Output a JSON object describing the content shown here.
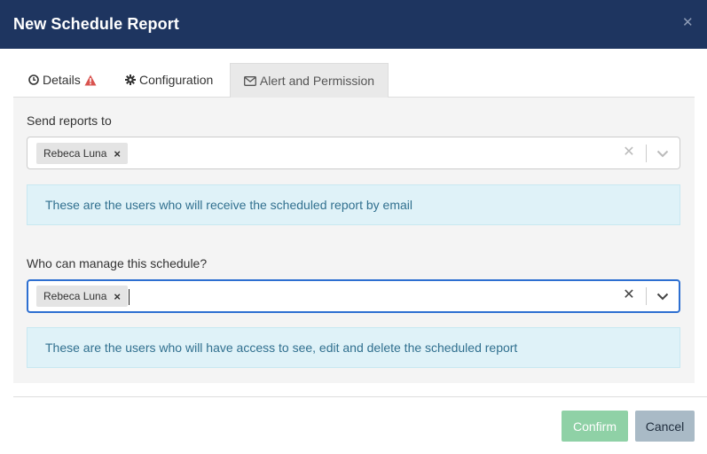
{
  "dialog": {
    "title": "New Schedule Report",
    "close_glyph": "✕"
  },
  "tabs": [
    {
      "label": "Details",
      "icon": "clock-icon",
      "has_warning": true
    },
    {
      "label": "Configuration",
      "icon": "gear-icon"
    },
    {
      "label": "Alert and Permission",
      "icon": "envelope-icon",
      "active": true
    }
  ],
  "send_reports": {
    "label": "Send reports to",
    "selected": [
      "Rebeca Luna"
    ],
    "info": "These are the users who will receive the scheduled report by email"
  },
  "manage_schedule": {
    "label": "Who can manage this schedule?",
    "selected": [
      "Rebeca Luna"
    ],
    "focused": true,
    "info": "These are the users who will have access to see, edit and delete the scheduled report"
  },
  "chip_remove_glyph": "×",
  "clear_glyph": "✕",
  "footer": {
    "confirm_label": "Confirm",
    "cancel_label": "Cancel"
  },
  "colors": {
    "header_bg": "#1e3560",
    "warning": "#d9534f",
    "focus_border": "#2d6fd1",
    "info_bg": "#dff2f8",
    "confirm_bg": "#8fd1a6",
    "cancel_bg": "#a9bac6"
  }
}
